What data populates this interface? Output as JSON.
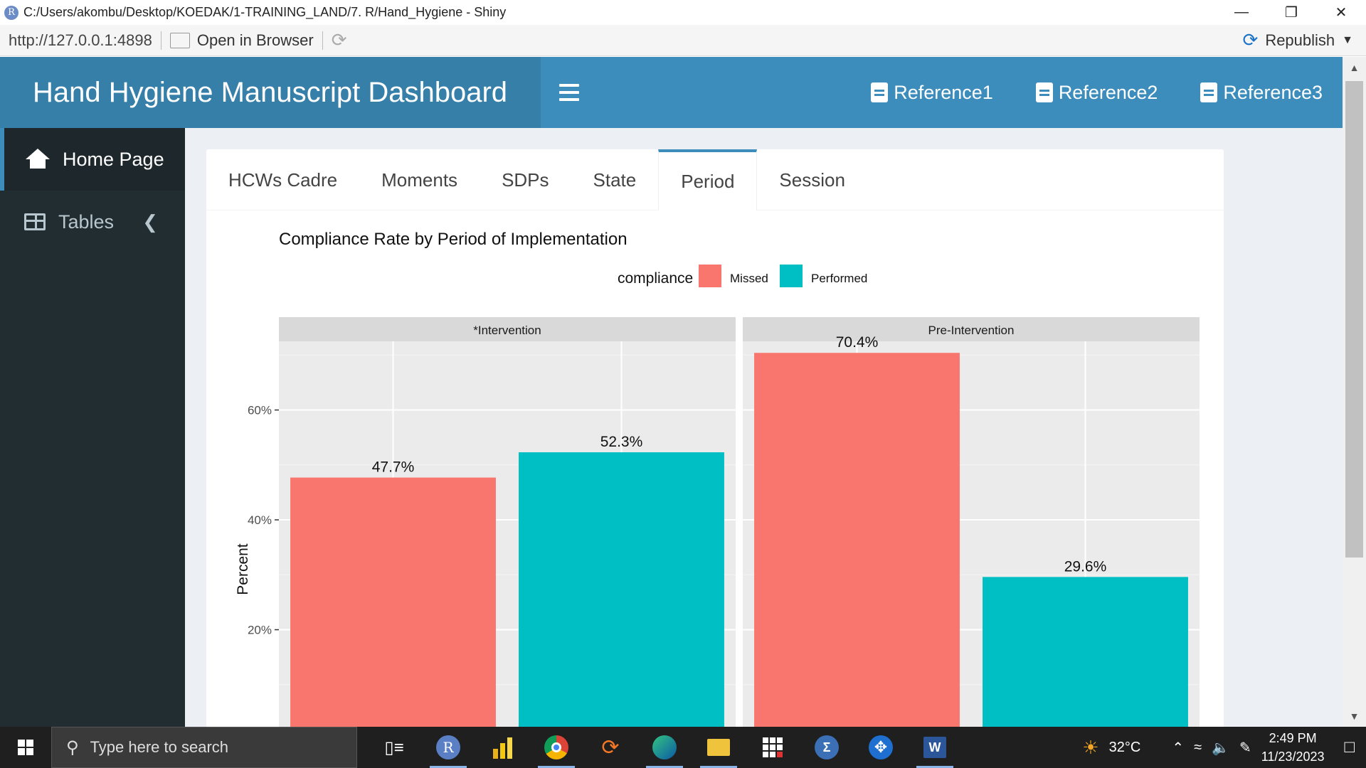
{
  "window": {
    "title": "C:/Users/akombu/Desktop/KOEDAK/1-TRAINING_LAND/7. R/Hand_Hygiene - Shiny",
    "app_icon_letter": "R"
  },
  "toolbar": {
    "url": "http://127.0.0.1:4898",
    "open_in_browser": "Open in Browser",
    "republish": "Republish"
  },
  "header": {
    "title": "Hand Hygiene Manuscript Dashboard",
    "refs": [
      "Reference1",
      "Reference2",
      "Reference3"
    ]
  },
  "sidebar": {
    "items": [
      {
        "label": "Home Page",
        "icon": "home-icon",
        "active": true
      },
      {
        "label": "Tables",
        "icon": "table-icon",
        "active": false
      }
    ]
  },
  "tabs": [
    {
      "label": "HCWs Cadre",
      "active": false
    },
    {
      "label": "Moments",
      "active": false
    },
    {
      "label": "SDPs",
      "active": false
    },
    {
      "label": "State",
      "active": false
    },
    {
      "label": "Period",
      "active": true
    },
    {
      "label": "Session",
      "active": false
    }
  ],
  "chart_data": {
    "type": "bar",
    "title": "Compliance Rate by Period of Implementation",
    "ylabel": "Percent",
    "xlabel": "",
    "legend": {
      "title": "compliance",
      "placement": "top"
    },
    "facets": [
      "*Intervention",
      "Pre-Intervention"
    ],
    "categories": [
      "Missed",
      "Performed"
    ],
    "series": [
      {
        "name": "Missed",
        "color": "#F8766D",
        "values": [
          47.7,
          70.4
        ]
      },
      {
        "name": "Performed",
        "color": "#00BFC4",
        "values": [
          52.3,
          29.6
        ]
      }
    ],
    "data_labels": [
      [
        "47.7%",
        "52.3%"
      ],
      [
        "70.4%",
        "29.6%"
      ]
    ],
    "yticks": [
      "20%",
      "40%",
      "60%"
    ],
    "ytick_values": [
      20,
      40,
      60
    ],
    "visible_ylim": [
      0,
      72.5
    ],
    "grid": true
  },
  "taskbar": {
    "search_placeholder": "Type here to search",
    "weather": "32°C",
    "time": "2:49 PM",
    "date": "11/23/2023",
    "app_r_letter": "R",
    "app_word_letter": "W"
  }
}
